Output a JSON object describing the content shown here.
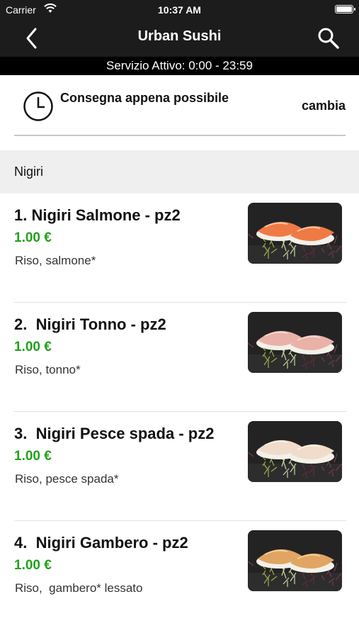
{
  "status": {
    "carrier": "Carrier",
    "time": "10:37 AM"
  },
  "nav": {
    "title": "Urban Sushi",
    "back_icon": "chevron-left-icon",
    "search_icon": "search-icon"
  },
  "service": {
    "text": "Servizio Attivo: 0:00 - 23:59"
  },
  "delivery": {
    "text": "Consegna appena possibile",
    "change_label": "cambia",
    "icon": "clock-icon"
  },
  "section": {
    "title": "Nigiri"
  },
  "items": [
    {
      "name": "1. Nigiri Salmone - pz2",
      "price": "1.00 €",
      "desc": "Riso, salmone*",
      "fish_color": "#f07a45",
      "stripe_color": "#ffc9a6"
    },
    {
      "name": "2.  Nigiri Tonno - pz2",
      "price": "1.00 €",
      "desc": "Riso, tonno*",
      "fish_color": "#e8b2a8",
      "stripe_color": "#f6d6cf"
    },
    {
      "name": "3.  Nigiri Pesce spada - pz2",
      "price": "1.00 €",
      "desc": "Riso, pesce spada*",
      "fish_color": "#f1dccb",
      "stripe_color": "#fbeee2"
    },
    {
      "name": "4.  Nigiri Gambero - pz2",
      "price": "1.00 €",
      "desc": "Riso,  gambero* lessato",
      "fish_color": "#e0a563",
      "stripe_color": "#f3cf94"
    }
  ],
  "colors": {
    "price": "#22a11b",
    "bar": "#1c1c1c",
    "section_bg": "#efefef"
  }
}
